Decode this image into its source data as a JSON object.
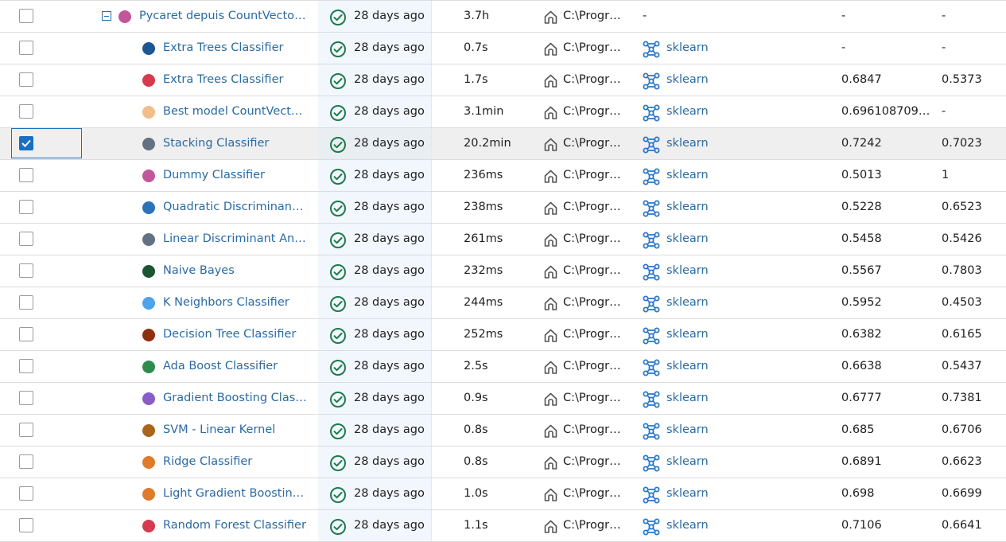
{
  "colors": {
    "link": "#2b6aa3",
    "status_success": "#1e7a4a",
    "selection_border": "#1c6fc2",
    "date_column_bg": "#f1f7fd"
  },
  "icons": {
    "status": "check-circle-icon",
    "source": "home-icon",
    "model_flavor": "sklearn-icon",
    "expand_toggle": "collapse-minus-icon"
  },
  "runs": [
    {
      "name": "Pycaret depuis CountVectorizer",
      "color": "#c2569b",
      "parent": true,
      "checked": false,
      "date": "28 days ago",
      "duration": "3.7h",
      "source": "C:\\Progr…",
      "model": "-",
      "m1": "-",
      "m2": "-"
    },
    {
      "name": "Extra Trees Classifier",
      "color": "#1c5693",
      "checked": false,
      "date": "28 days ago",
      "duration": "0.7s",
      "source": "C:\\Progr…",
      "model": "sklearn",
      "m1": "-",
      "m2": "-"
    },
    {
      "name": "Extra Trees Classifier",
      "color": "#d63a4f",
      "checked": false,
      "date": "28 days ago",
      "duration": "1.7s",
      "source": "C:\\Progr…",
      "model": "sklearn",
      "m1": "0.6847",
      "m2": "0.5373"
    },
    {
      "name": "Best model CountVectori…",
      "color": "#f1bd8a",
      "checked": false,
      "date": "28 days ago",
      "duration": "3.1min",
      "source": "C:\\Progr…",
      "model": "sklearn",
      "m1": "0.696108709…",
      "m2": "-"
    },
    {
      "name": "Stacking Classifier",
      "color": "#637283",
      "checked": true,
      "selected": true,
      "date": "28 days ago",
      "duration": "20.2min",
      "source": "C:\\Progr…",
      "model": "sklearn",
      "m1": "0.7242",
      "m2": "0.7023"
    },
    {
      "name": "Dummy Classifier",
      "color": "#c2569b",
      "checked": false,
      "date": "28 days ago",
      "duration": "236ms",
      "source": "C:\\Progr…",
      "model": "sklearn",
      "m1": "0.5013",
      "m2": "1"
    },
    {
      "name": "Quadratic Discriminant A…",
      "color": "#2c72bb",
      "checked": false,
      "date": "28 days ago",
      "duration": "238ms",
      "source": "C:\\Progr…",
      "model": "sklearn",
      "m1": "0.5228",
      "m2": "0.6523"
    },
    {
      "name": "Linear Discriminant Analy…",
      "color": "#637283",
      "checked": false,
      "date": "28 days ago",
      "duration": "261ms",
      "source": "C:\\Progr…",
      "model": "sklearn",
      "m1": "0.5458",
      "m2": "0.5426"
    },
    {
      "name": "Naive Bayes",
      "color": "#1a5433",
      "checked": false,
      "date": "28 days ago",
      "duration": "232ms",
      "source": "C:\\Progr…",
      "model": "sklearn",
      "m1": "0.5567",
      "m2": "0.7803"
    },
    {
      "name": "K Neighbors Classifier",
      "color": "#4ea4ea",
      "checked": false,
      "date": "28 days ago",
      "duration": "244ms",
      "source": "C:\\Progr…",
      "model": "sklearn",
      "m1": "0.5952",
      "m2": "0.4503"
    },
    {
      "name": "Decision Tree Classifier",
      "color": "#8f2f12",
      "checked": false,
      "date": "28 days ago",
      "duration": "252ms",
      "source": "C:\\Progr…",
      "model": "sklearn",
      "m1": "0.6382",
      "m2": "0.6165"
    },
    {
      "name": "Ada Boost Classifier",
      "color": "#2e8b4e",
      "checked": false,
      "date": "28 days ago",
      "duration": "2.5s",
      "source": "C:\\Progr…",
      "model": "sklearn",
      "m1": "0.6638",
      "m2": "0.5437"
    },
    {
      "name": "Gradient Boosting Classifi…",
      "color": "#8a5cc7",
      "checked": false,
      "date": "28 days ago",
      "duration": "0.9s",
      "source": "C:\\Progr…",
      "model": "sklearn",
      "m1": "0.6777",
      "m2": "0.7381"
    },
    {
      "name": "SVM - Linear Kernel",
      "color": "#a9661a",
      "checked": false,
      "date": "28 days ago",
      "duration": "0.8s",
      "source": "C:\\Progr…",
      "model": "sklearn",
      "m1": "0.685",
      "m2": "0.6706"
    },
    {
      "name": "Ridge Classifier",
      "color": "#e07b2a",
      "checked": false,
      "date": "28 days ago",
      "duration": "0.8s",
      "source": "C:\\Progr…",
      "model": "sklearn",
      "m1": "0.6891",
      "m2": "0.6623"
    },
    {
      "name": "Light Gradient Boosting …",
      "color": "#e07b2a",
      "checked": false,
      "date": "28 days ago",
      "duration": "1.0s",
      "source": "C:\\Progr…",
      "model": "sklearn",
      "m1": "0.698",
      "m2": "0.6699"
    },
    {
      "name": "Random Forest Classifier",
      "color": "#d63a4f",
      "checked": false,
      "date": "28 days ago",
      "duration": "1.1s",
      "source": "C:\\Progr…",
      "model": "sklearn",
      "m1": "0.7106",
      "m2": "0.6641"
    }
  ]
}
